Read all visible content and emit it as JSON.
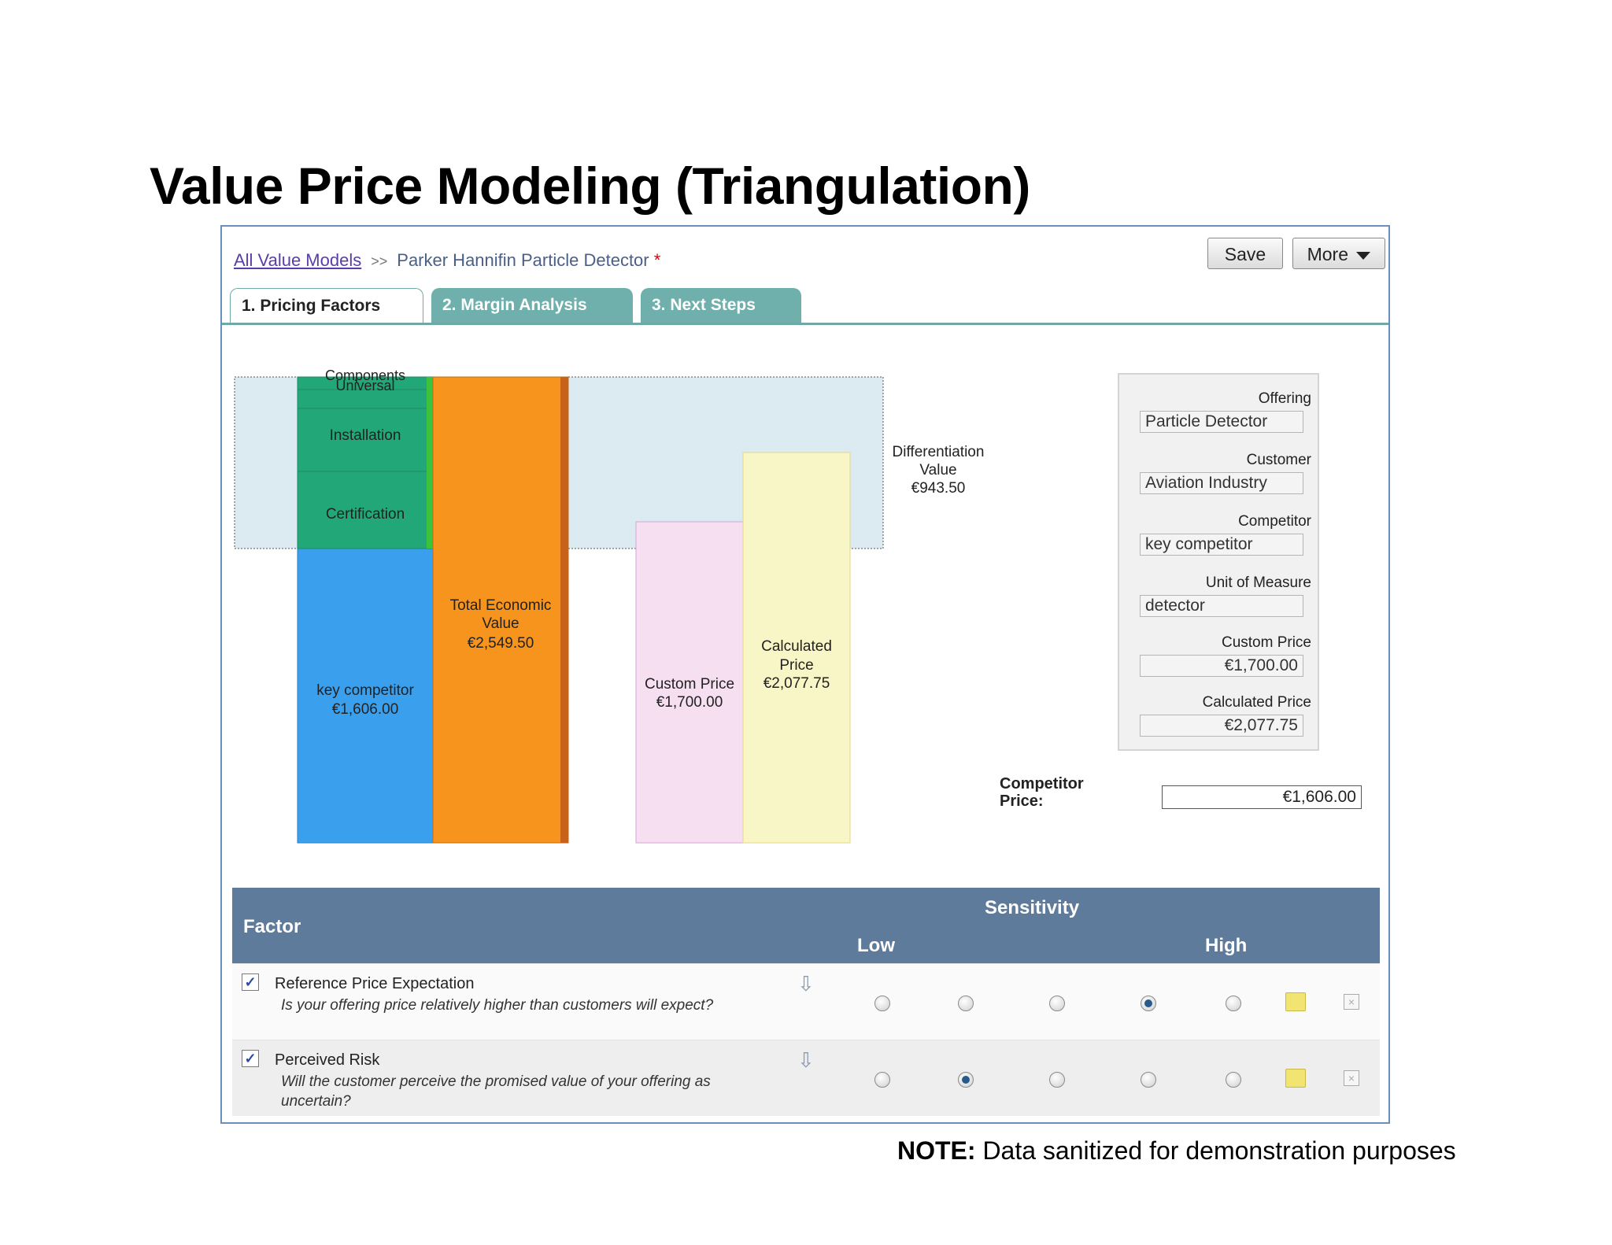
{
  "slide": {
    "title": "Value Price Modeling (Triangulation)",
    "note_bold": "NOTE:",
    "note_text": " Data sanitized for demonstration purposes"
  },
  "breadcrumb": {
    "root": "All Value Models",
    "separator": ">>",
    "current": "Parker Hannifin Particle Detector",
    "unsaved_marker": "*"
  },
  "toolbar": {
    "save_label": "Save",
    "more_label": "More"
  },
  "tabs": [
    {
      "label": "1. Pricing Factors",
      "active": true
    },
    {
      "label": "2. Margin Analysis",
      "active": false
    },
    {
      "label": "3. Next Steps",
      "active": false
    }
  ],
  "chart_data": {
    "type": "bar",
    "currency": "€",
    "segments": {
      "key_competitor": {
        "label": "key competitor",
        "value_text": "€1,606.00",
        "value": 1606.0,
        "color": "#3aa0ee"
      },
      "certification": {
        "label": "Certification",
        "color": "#22a878"
      },
      "installation": {
        "label": "Installation",
        "color": "#22a878"
      },
      "universal": {
        "label": "Universal",
        "color": "#22a878"
      },
      "components": {
        "label": "Components",
        "color": "#22a878"
      }
    },
    "total_economic_value": {
      "label": "Total Economic Value",
      "value_text": "€2,549.50",
      "value": 2549.5,
      "color": "#f7941d"
    },
    "custom_price": {
      "label": "Custom Price",
      "value_text": "€1,700.00",
      "value": 1700.0,
      "color": "#f6dff0"
    },
    "calculated_price": {
      "label": "Calculated Price",
      "value_text": "€2,077.75",
      "value": 2077.75,
      "color": "#f8f5c6"
    },
    "differentiation_value": {
      "label": "Differentiation Value",
      "value_text": "€943.50",
      "value": 943.5,
      "color": "#dcebf2"
    }
  },
  "details_panel": {
    "offering_label": "Offering",
    "offering_value": "Particle Detector",
    "customer_label": "Customer",
    "customer_value": "Aviation Industry",
    "competitor_label": "Competitor",
    "competitor_value": "key competitor",
    "unit_label": "Unit of Measure",
    "unit_value": "detector",
    "custom_price_label": "Custom Price",
    "custom_price_value": "€1,700.00",
    "calculated_price_label": "Calculated Price",
    "calculated_price_value": "€2,077.75"
  },
  "competitor_price": {
    "label_line1": "Competitor",
    "label_line2": "Price:",
    "value": "€1,606.00"
  },
  "factors_table": {
    "factor_header": "Factor",
    "sensitivity_header": "Sensitivity",
    "low_label": "Low",
    "high_label": "High",
    "rows": [
      {
        "name": "Reference Price Expectation",
        "question": "Is your offering price relatively higher than customers will expect?",
        "checked": true,
        "selected_index": 3
      },
      {
        "name": "Perceived Risk",
        "question": "Will the customer perceive the promised value of your offering as uncertain?",
        "checked": true,
        "selected_index": 1
      }
    ]
  }
}
